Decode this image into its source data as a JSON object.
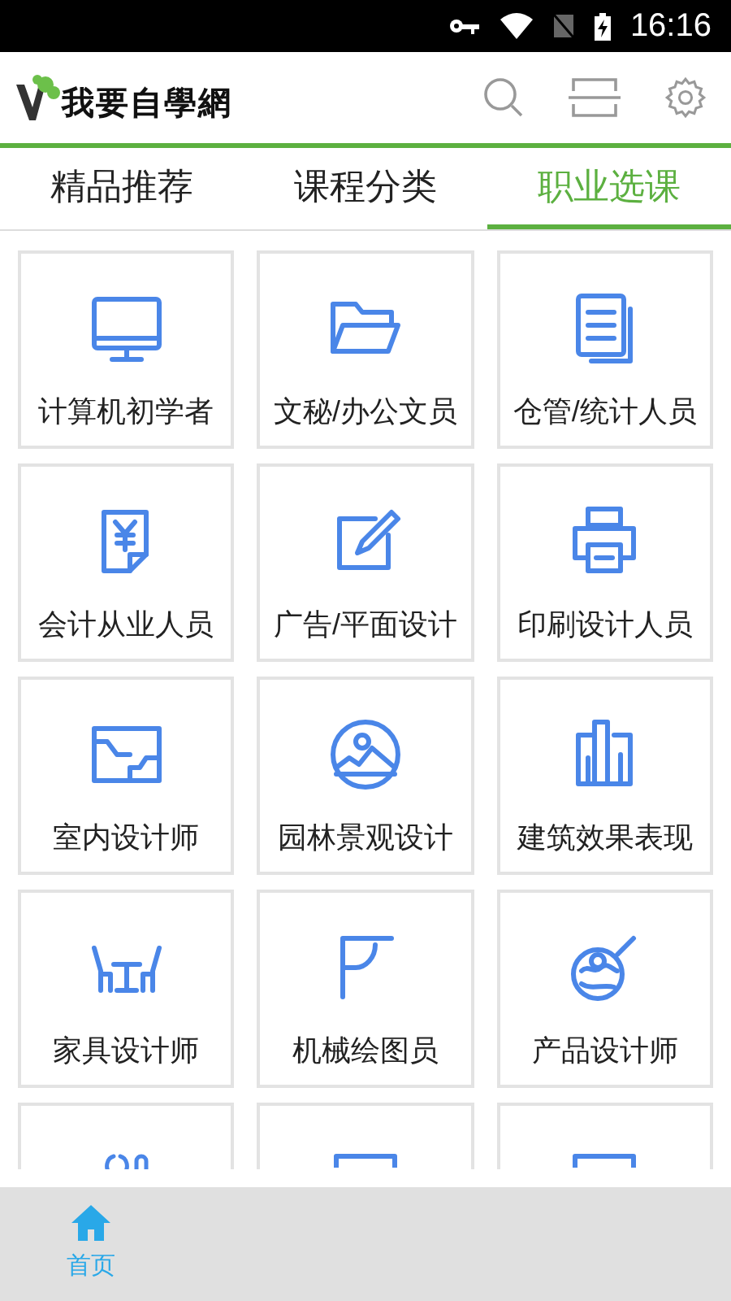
{
  "status_bar": {
    "time": "16:16"
  },
  "header": {
    "logo_text": "我要自學網"
  },
  "tabs": [
    {
      "label": "精品推荐",
      "selected": false
    },
    {
      "label": "课程分类",
      "selected": false
    },
    {
      "label": "职业选课",
      "selected": true
    }
  ],
  "tiles": [
    {
      "kind": "tile",
      "label": "计算机初学者"
    },
    {
      "kind": "tile",
      "label": "文秘/办公文员"
    },
    {
      "kind": "tile",
      "label": "仓管/统计人员"
    },
    {
      "kind": "tile",
      "label": "会计从业人员"
    },
    {
      "kind": "tile",
      "label": "广告/平面设计"
    },
    {
      "kind": "tile",
      "label": "印刷设计人员"
    },
    {
      "kind": "tile",
      "label": "室内设计师"
    },
    {
      "kind": "tile",
      "label": "园林景观设计"
    },
    {
      "kind": "tile",
      "label": "建筑效果表现"
    },
    {
      "kind": "tile",
      "label": "家具设计师"
    },
    {
      "kind": "tile",
      "label": "机械绘图员"
    },
    {
      "kind": "tile",
      "label": "产品设计师"
    },
    {
      "kind": "cut"
    },
    {
      "kind": "cut"
    },
    {
      "kind": "cut"
    }
  ],
  "bottom_nav": [
    {
      "label": "首页",
      "selected": true
    }
  ]
}
